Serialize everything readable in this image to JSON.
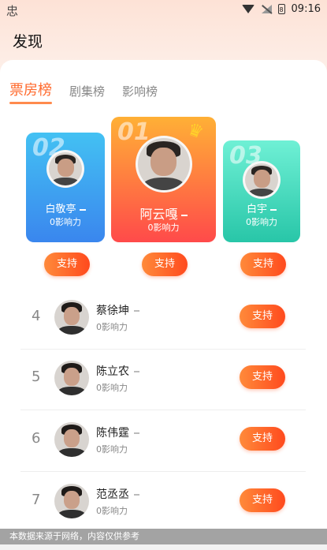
{
  "status_bar": {
    "app_icon": "忠",
    "time": "09:16",
    "battery_label": "8"
  },
  "page": {
    "title": "发现"
  },
  "tabs": [
    {
      "label": "票房榜",
      "active": true
    },
    {
      "label": "剧集榜",
      "active": false
    },
    {
      "label": "影响榜",
      "active": false
    }
  ],
  "podium": [
    {
      "rank": "02",
      "name": "白敬亭",
      "influence": "0影响力"
    },
    {
      "rank": "01",
      "name": "阿云嘎",
      "influence": "0影响力"
    },
    {
      "rank": "03",
      "name": "白宇",
      "influence": "0影响力"
    }
  ],
  "support_label": "支持",
  "list": [
    {
      "rank": "4",
      "name": "蔡徐坤",
      "influence": "0影响力"
    },
    {
      "rank": "5",
      "name": "陈立农",
      "influence": "0影响力"
    },
    {
      "rank": "6",
      "name": "陈伟霆",
      "influence": "0影响力"
    },
    {
      "rank": "7",
      "name": "范丞丞",
      "influence": "0影响力"
    }
  ],
  "footer": {
    "note": "本数据来源于网络，内容仅供参考"
  },
  "colors": {
    "accent": "#ff6a2d",
    "first": "#ff4a4a",
    "second": "#3a86ee",
    "third": "#28c6a8"
  }
}
